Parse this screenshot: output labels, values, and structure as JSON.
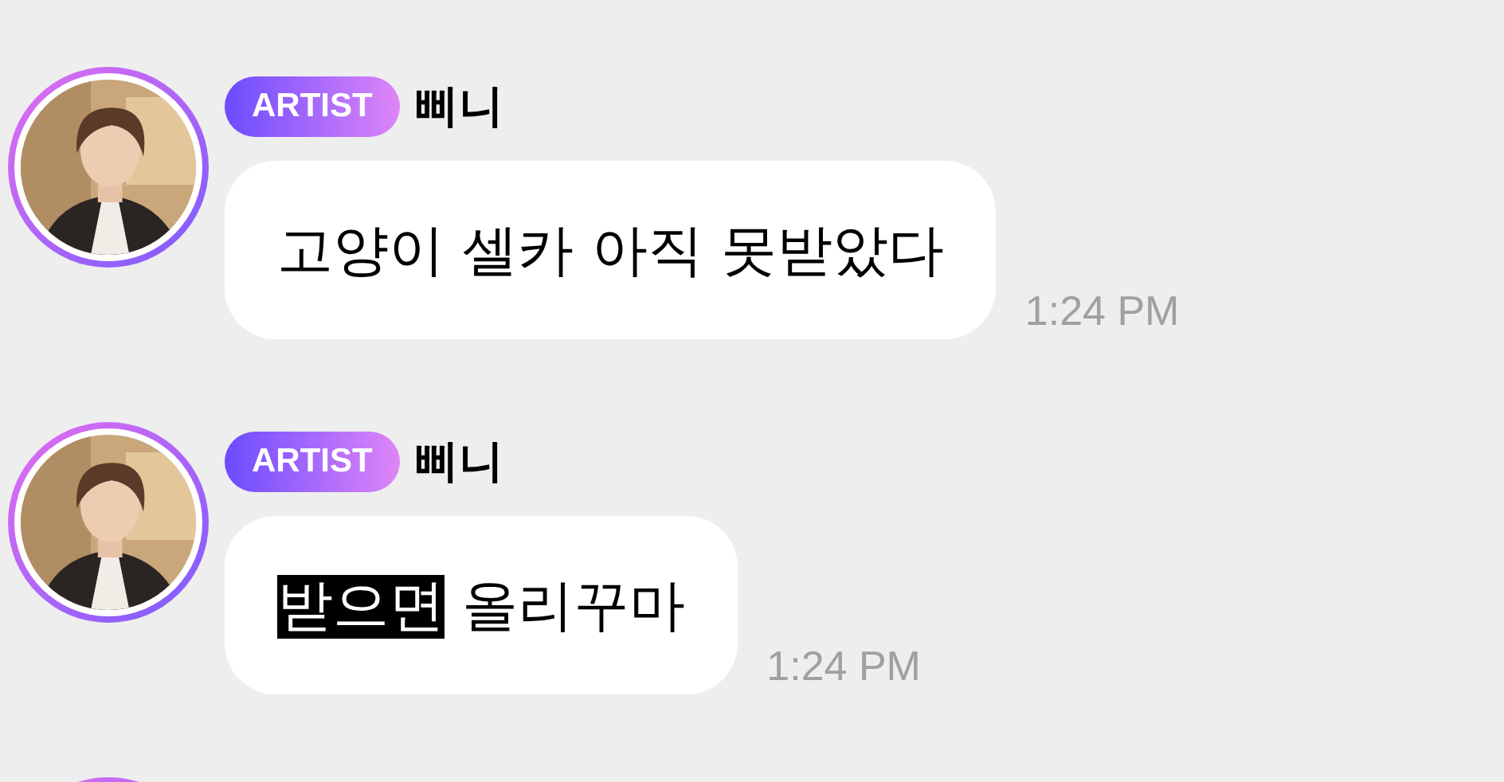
{
  "messages": [
    {
      "kind": "message",
      "badge": "ARTIST",
      "name": "삐니",
      "parts": [
        {
          "text": "고양이 셀카 아직 못받았다",
          "highlighted": false
        }
      ],
      "time": "1:24 PM"
    },
    {
      "kind": "message",
      "badge": "ARTIST",
      "name": "삐니",
      "parts": [
        {
          "text": "받으면",
          "highlighted": true
        },
        {
          "text": " 올리꾸마",
          "highlighted": false
        }
      ],
      "time": "1:24 PM"
    },
    {
      "kind": "avatar_only"
    }
  ]
}
